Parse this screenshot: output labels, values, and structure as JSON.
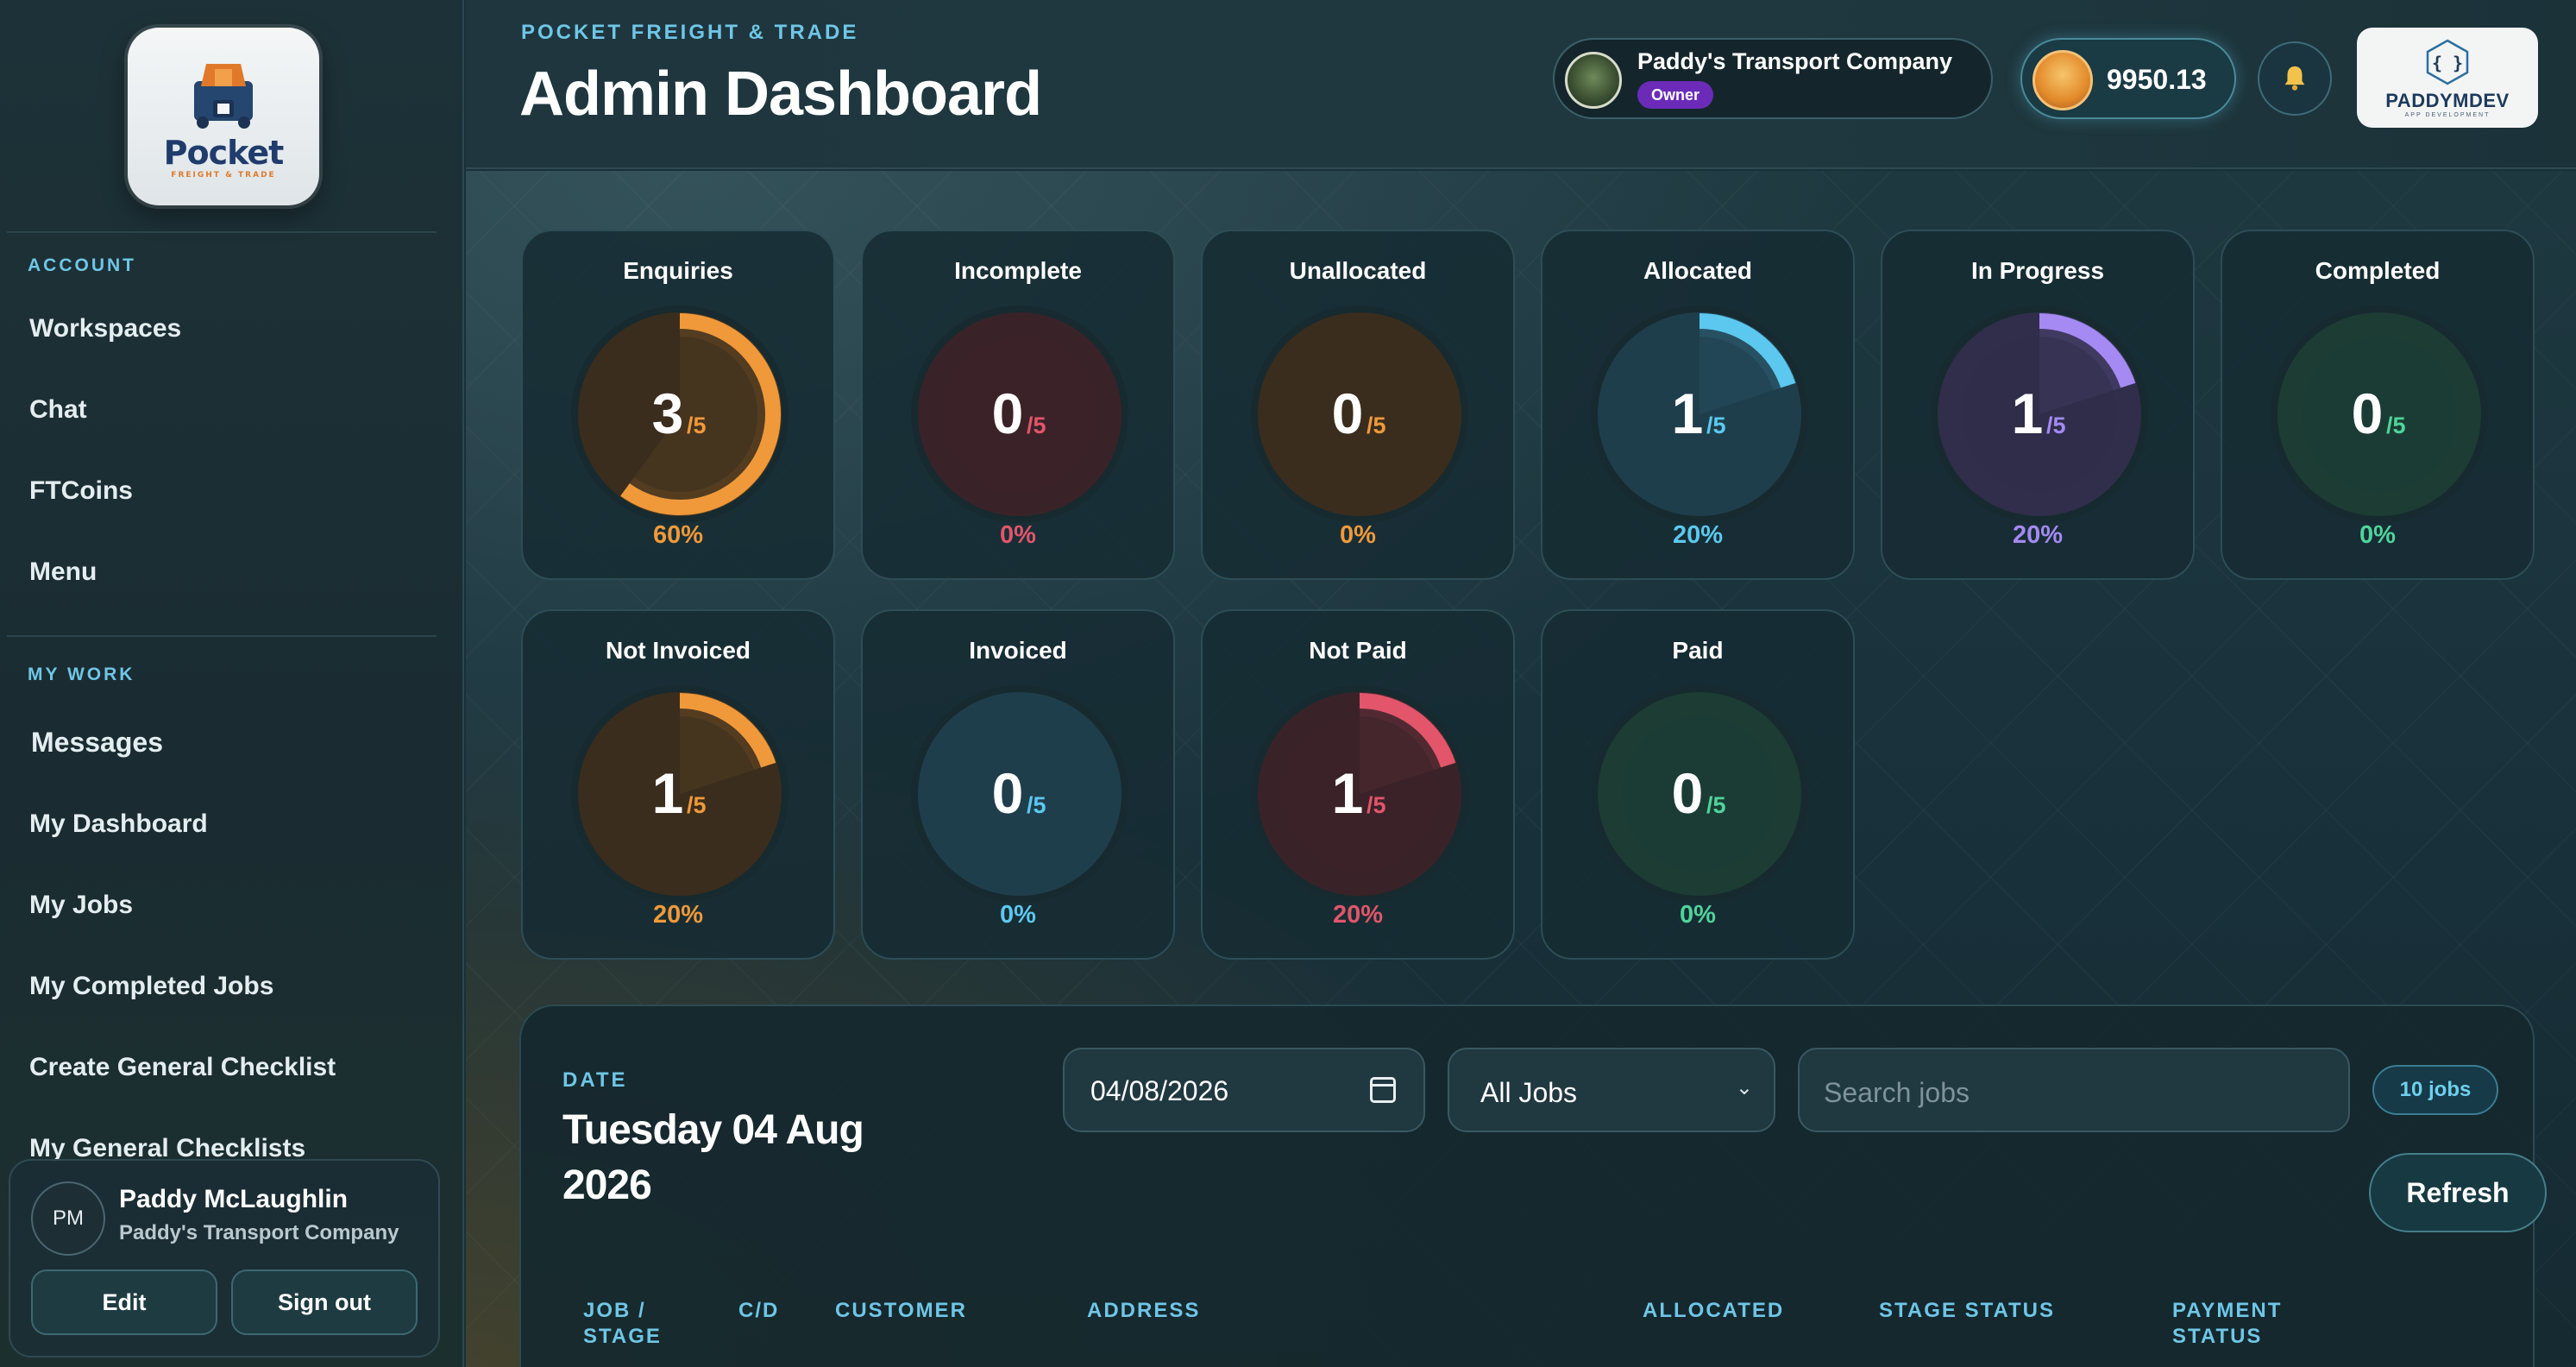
{
  "sidebar": {
    "logo": {
      "word": "Pocket",
      "sub": "FREIGHT & TRADE"
    },
    "account_section": "ACCOUNT",
    "account_items": [
      "Workspaces",
      "Chat",
      "FTCoins",
      "Menu"
    ],
    "work_section": "MY WORK",
    "work_items": [
      "Messages",
      "My Dashboard",
      "My Jobs",
      "My Completed Jobs",
      "Create General Checklist",
      "My General Checklists"
    ],
    "user": {
      "initials": "PM",
      "name": "Paddy McLaughlin",
      "company": "Paddy's Transport Company",
      "edit_label": "Edit",
      "signout_label": "Sign out"
    }
  },
  "header": {
    "kicker": "POCKET FREIGHT & TRADE",
    "title": "Admin Dashboard",
    "company": {
      "name": "Paddy's Transport Company",
      "role": "Owner"
    },
    "coins": "9950.13",
    "bell_icon": "bell-icon",
    "brand": {
      "name": "PADDYMDEV",
      "sub": "APP DEVELOPMENT"
    }
  },
  "stats": [
    {
      "title": "Enquiries",
      "value": "3",
      "total": "/5",
      "pct": "60%",
      "fraction": 0.6,
      "color": "#f0993a",
      "fill": "#3a2d1d"
    },
    {
      "title": "Incomplete",
      "value": "0",
      "total": "/5",
      "pct": "0%",
      "fraction": 0,
      "color": "#e2556a",
      "fill": "#3a2328"
    },
    {
      "title": "Unallocated",
      "value": "0",
      "total": "/5",
      "pct": "0%",
      "fraction": 0,
      "color": "#f0993a",
      "fill": "#3a2d1d"
    },
    {
      "title": "Allocated",
      "value": "1",
      "total": "/5",
      "pct": "20%",
      "fraction": 0.2,
      "color": "#5cc8ef",
      "fill": "#1f3e4c"
    },
    {
      "title": "In Progress",
      "value": "1",
      "total": "/5",
      "pct": "20%",
      "fraction": 0.2,
      "color": "#a48af2",
      "fill": "#302e4a"
    },
    {
      "title": "Completed",
      "value": "0",
      "total": "/5",
      "pct": "0%",
      "fraction": 0,
      "color": "#4fd49b",
      "fill": "#1c3c34"
    },
    {
      "title": "Not Invoiced",
      "value": "1",
      "total": "/5",
      "pct": "20%",
      "fraction": 0.2,
      "color": "#f0993a",
      "fill": "#3a2d1d"
    },
    {
      "title": "Invoiced",
      "value": "0",
      "total": "/5",
      "pct": "0%",
      "fraction": 0,
      "color": "#5cc8ef",
      "fill": "#1f3e4c"
    },
    {
      "title": "Not Paid",
      "value": "1",
      "total": "/5",
      "pct": "20%",
      "fraction": 0.2,
      "color": "#e2556a",
      "fill": "#3a2328"
    },
    {
      "title": "Paid",
      "value": "0",
      "total": "/5",
      "pct": "0%",
      "fraction": 0,
      "color": "#4fd49b",
      "fill": "#1c3c34"
    }
  ],
  "jobs": {
    "date_label": "DATE",
    "date_value": "Tuesday 04 Aug 2026",
    "date_input": "04/08/2026",
    "filter_value": "All Jobs",
    "search_placeholder": "Search jobs",
    "count": "10 jobs",
    "refresh_label": "Refresh",
    "columns": [
      "JOB / STAGE",
      "C/D",
      "CUSTOMER",
      "ADDRESS",
      "ALLOCATED",
      "STAGE STATUS",
      "PAYMENT STATUS"
    ]
  }
}
